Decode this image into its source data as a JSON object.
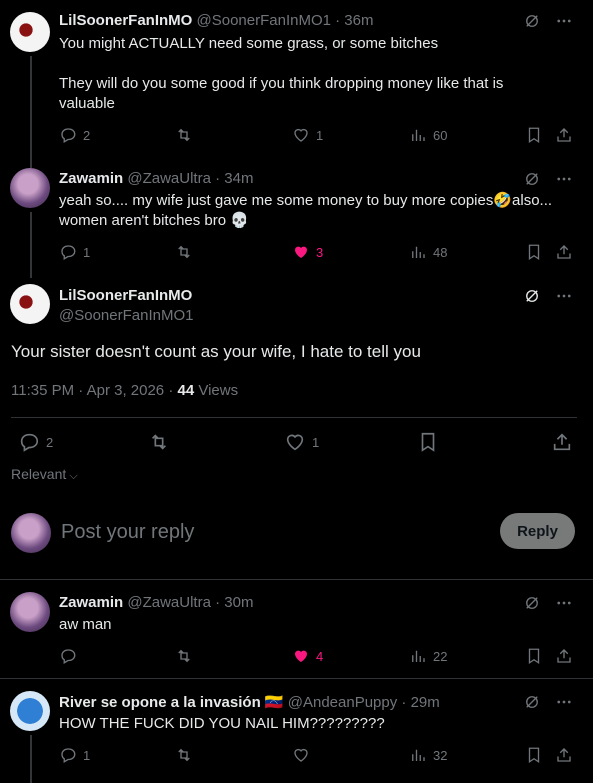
{
  "posts": [
    {
      "name": "LilSoonerFanInMO",
      "handle_time": "@SoonerFanInMO1 · 36m",
      "text1": "You might ACTUALLY need some grass, or some bitches",
      "text2": "They will do you some good if you think dropping money like that is",
      "text3": "valuable",
      "replies": "2",
      "retweets": "",
      "likes": "1",
      "views": "60"
    },
    {
      "name": "Zawamin",
      "handle_time": "@ZawaUltra · 34m",
      "text1": "yeah so.... my wife just gave me some money to buy more copies🤣also...",
      "text2": "women aren't bitches bro 💀",
      "replies": "1",
      "likes": "3",
      "views": "48"
    }
  ],
  "main": {
    "name": "LilSoonerFanInMO",
    "handle": "@SoonerFanInMO1",
    "text": "Your sister doesn't count as your wife, I hate to tell you",
    "time": "11:35 PM · Apr 3, 2026 · ",
    "views_count": "44",
    "views_label": " Views",
    "replies": "2",
    "likes": "1"
  },
  "filter": {
    "label": "Relevant"
  },
  "composer": {
    "placeholder": "Post your reply",
    "button": "Reply"
  },
  "replies": [
    {
      "name": "Zawamin",
      "handle_time": "@ZawaUltra · 30m",
      "text": "aw man",
      "replies": "",
      "likes": "4",
      "views": "22"
    },
    {
      "name": "River se opone a la invasión 🇻🇪",
      "handle_time": "@AndeanPuppy · 29m",
      "text": "HOW THE FUCK DID YOU NAIL HIM?????????",
      "replies": "1",
      "likes": "",
      "views": "32"
    }
  ],
  "icons": {
    "grok": "grok-icon",
    "more": "more-icon",
    "reply": "reply-icon",
    "retweet": "retweet-icon",
    "like": "like-icon",
    "views": "views-icon",
    "bookmark": "bookmark-icon",
    "share": "share-icon"
  },
  "colors": {
    "like_active": "#f91880",
    "muted": "#71767b",
    "background": "#000000"
  }
}
